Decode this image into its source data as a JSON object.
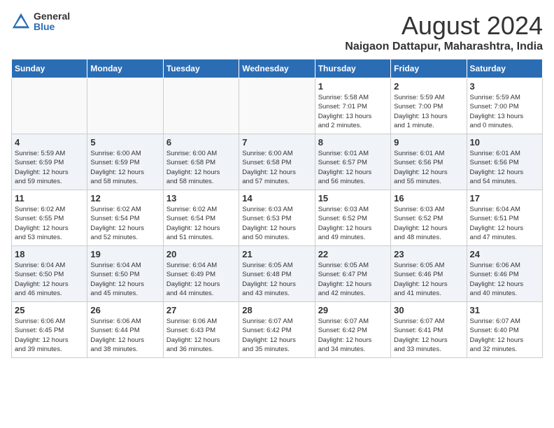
{
  "header": {
    "logo_general": "General",
    "logo_blue": "Blue",
    "month_title": "August 2024",
    "location": "Naigaon Dattapur, Maharashtra, India"
  },
  "weekdays": [
    "Sunday",
    "Monday",
    "Tuesday",
    "Wednesday",
    "Thursday",
    "Friday",
    "Saturday"
  ],
  "weeks": [
    [
      {
        "day": "",
        "info": ""
      },
      {
        "day": "",
        "info": ""
      },
      {
        "day": "",
        "info": ""
      },
      {
        "day": "",
        "info": ""
      },
      {
        "day": "1",
        "info": "Sunrise: 5:58 AM\nSunset: 7:01 PM\nDaylight: 13 hours\nand 2 minutes."
      },
      {
        "day": "2",
        "info": "Sunrise: 5:59 AM\nSunset: 7:00 PM\nDaylight: 13 hours\nand 1 minute."
      },
      {
        "day": "3",
        "info": "Sunrise: 5:59 AM\nSunset: 7:00 PM\nDaylight: 13 hours\nand 0 minutes."
      }
    ],
    [
      {
        "day": "4",
        "info": "Sunrise: 5:59 AM\nSunset: 6:59 PM\nDaylight: 12 hours\nand 59 minutes."
      },
      {
        "day": "5",
        "info": "Sunrise: 6:00 AM\nSunset: 6:59 PM\nDaylight: 12 hours\nand 58 minutes."
      },
      {
        "day": "6",
        "info": "Sunrise: 6:00 AM\nSunset: 6:58 PM\nDaylight: 12 hours\nand 58 minutes."
      },
      {
        "day": "7",
        "info": "Sunrise: 6:00 AM\nSunset: 6:58 PM\nDaylight: 12 hours\nand 57 minutes."
      },
      {
        "day": "8",
        "info": "Sunrise: 6:01 AM\nSunset: 6:57 PM\nDaylight: 12 hours\nand 56 minutes."
      },
      {
        "day": "9",
        "info": "Sunrise: 6:01 AM\nSunset: 6:56 PM\nDaylight: 12 hours\nand 55 minutes."
      },
      {
        "day": "10",
        "info": "Sunrise: 6:01 AM\nSunset: 6:56 PM\nDaylight: 12 hours\nand 54 minutes."
      }
    ],
    [
      {
        "day": "11",
        "info": "Sunrise: 6:02 AM\nSunset: 6:55 PM\nDaylight: 12 hours\nand 53 minutes."
      },
      {
        "day": "12",
        "info": "Sunrise: 6:02 AM\nSunset: 6:54 PM\nDaylight: 12 hours\nand 52 minutes."
      },
      {
        "day": "13",
        "info": "Sunrise: 6:02 AM\nSunset: 6:54 PM\nDaylight: 12 hours\nand 51 minutes."
      },
      {
        "day": "14",
        "info": "Sunrise: 6:03 AM\nSunset: 6:53 PM\nDaylight: 12 hours\nand 50 minutes."
      },
      {
        "day": "15",
        "info": "Sunrise: 6:03 AM\nSunset: 6:52 PM\nDaylight: 12 hours\nand 49 minutes."
      },
      {
        "day": "16",
        "info": "Sunrise: 6:03 AM\nSunset: 6:52 PM\nDaylight: 12 hours\nand 48 minutes."
      },
      {
        "day": "17",
        "info": "Sunrise: 6:04 AM\nSunset: 6:51 PM\nDaylight: 12 hours\nand 47 minutes."
      }
    ],
    [
      {
        "day": "18",
        "info": "Sunrise: 6:04 AM\nSunset: 6:50 PM\nDaylight: 12 hours\nand 46 minutes."
      },
      {
        "day": "19",
        "info": "Sunrise: 6:04 AM\nSunset: 6:50 PM\nDaylight: 12 hours\nand 45 minutes."
      },
      {
        "day": "20",
        "info": "Sunrise: 6:04 AM\nSunset: 6:49 PM\nDaylight: 12 hours\nand 44 minutes."
      },
      {
        "day": "21",
        "info": "Sunrise: 6:05 AM\nSunset: 6:48 PM\nDaylight: 12 hours\nand 43 minutes."
      },
      {
        "day": "22",
        "info": "Sunrise: 6:05 AM\nSunset: 6:47 PM\nDaylight: 12 hours\nand 42 minutes."
      },
      {
        "day": "23",
        "info": "Sunrise: 6:05 AM\nSunset: 6:46 PM\nDaylight: 12 hours\nand 41 minutes."
      },
      {
        "day": "24",
        "info": "Sunrise: 6:06 AM\nSunset: 6:46 PM\nDaylight: 12 hours\nand 40 minutes."
      }
    ],
    [
      {
        "day": "25",
        "info": "Sunrise: 6:06 AM\nSunset: 6:45 PM\nDaylight: 12 hours\nand 39 minutes."
      },
      {
        "day": "26",
        "info": "Sunrise: 6:06 AM\nSunset: 6:44 PM\nDaylight: 12 hours\nand 38 minutes."
      },
      {
        "day": "27",
        "info": "Sunrise: 6:06 AM\nSunset: 6:43 PM\nDaylight: 12 hours\nand 36 minutes."
      },
      {
        "day": "28",
        "info": "Sunrise: 6:07 AM\nSunset: 6:42 PM\nDaylight: 12 hours\nand 35 minutes."
      },
      {
        "day": "29",
        "info": "Sunrise: 6:07 AM\nSunset: 6:42 PM\nDaylight: 12 hours\nand 34 minutes."
      },
      {
        "day": "30",
        "info": "Sunrise: 6:07 AM\nSunset: 6:41 PM\nDaylight: 12 hours\nand 33 minutes."
      },
      {
        "day": "31",
        "info": "Sunrise: 6:07 AM\nSunset: 6:40 PM\nDaylight: 12 hours\nand 32 minutes."
      }
    ]
  ]
}
